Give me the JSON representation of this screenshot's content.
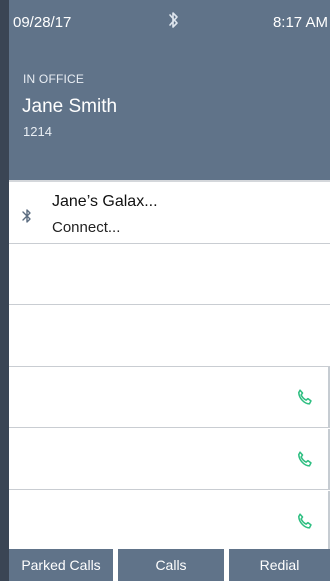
{
  "status_bar": {
    "date": "09/28/17",
    "time": "8:17 AM",
    "bluetooth_icon": "bluetooth-icon"
  },
  "header": {
    "presence": "IN OFFICE",
    "name": "Jane Smith",
    "extension": "1214"
  },
  "device": {
    "name": "Jane’s Galax...",
    "status": "Connect...",
    "icon": "bluetooth-icon"
  },
  "call_rows": [
    {
      "icon": "phone-icon"
    },
    {
      "icon": "phone-icon"
    },
    {
      "icon": "phone-icon"
    }
  ],
  "softkeys": {
    "parked_calls": "Parked Calls",
    "calls": "Calls",
    "redial": "Redial"
  },
  "colors": {
    "header_bg": "#607389",
    "softkey_bg": "#607389",
    "phone_icon": "#2fbf82",
    "divider": "#c9cdd2"
  }
}
